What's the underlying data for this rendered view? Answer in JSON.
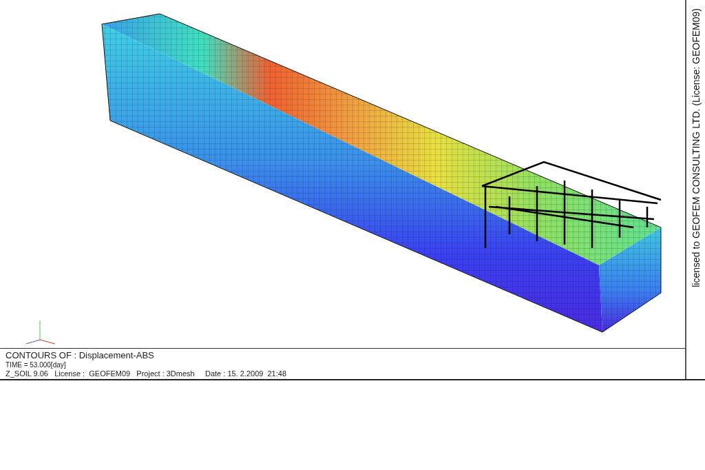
{
  "viewport": {
    "license_notice": "licensed to GEOFEM CONSULTING LTD. (License: GEOFEM09)"
  },
  "info_panel": {
    "contours_of": "CONTOURS OF : Displacement-ABS",
    "time": "TIME = 53.000[day]",
    "footer": "Z_SOIL 9.06   License :  GEOFEM09   Project : 3Dmesh     Date : 15. 2.2009  21:48"
  }
}
